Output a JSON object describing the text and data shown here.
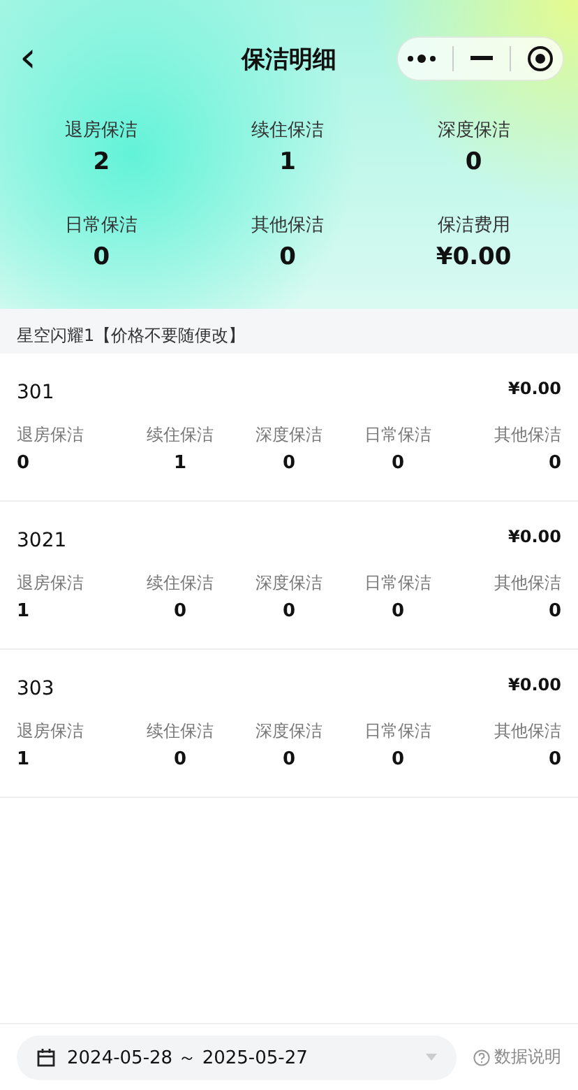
{
  "header": {
    "back": "‹",
    "title": "保洁明细"
  },
  "summary": [
    {
      "label": "退房保洁",
      "value": "2"
    },
    {
      "label": "续住保洁",
      "value": "1"
    },
    {
      "label": "深度保洁",
      "value": "0"
    },
    {
      "label": "日常保洁",
      "value": "0"
    },
    {
      "label": "其他保洁",
      "value": "0"
    },
    {
      "label": "保洁费用",
      "value": "¥0.00"
    }
  ],
  "group": "星空闪耀1【价格不要随便改】",
  "rooms": [
    {
      "room": "301",
      "amount": "¥0.00",
      "stats": [
        {
          "label": "退房保洁",
          "value": "0"
        },
        {
          "label": "续住保洁",
          "value": "1"
        },
        {
          "label": "深度保洁",
          "value": "0"
        },
        {
          "label": "日常保洁",
          "value": "0"
        },
        {
          "label": "其他保洁",
          "value": "0"
        }
      ]
    },
    {
      "room": "3021",
      "amount": "¥0.00",
      "stats": [
        {
          "label": "退房保洁",
          "value": "1"
        },
        {
          "label": "续住保洁",
          "value": "0"
        },
        {
          "label": "深度保洁",
          "value": "0"
        },
        {
          "label": "日常保洁",
          "value": "0"
        },
        {
          "label": "其他保洁",
          "value": "0"
        }
      ]
    },
    {
      "room": "303",
      "amount": "¥0.00",
      "stats": [
        {
          "label": "退房保洁",
          "value": "1"
        },
        {
          "label": "续住保洁",
          "value": "0"
        },
        {
          "label": "深度保洁",
          "value": "0"
        },
        {
          "label": "日常保洁",
          "value": "0"
        },
        {
          "label": "其他保洁",
          "value": "0"
        }
      ]
    }
  ],
  "footer": {
    "date_range": "2024-05-28 ～ 2025-05-27",
    "help": "数据说明"
  }
}
